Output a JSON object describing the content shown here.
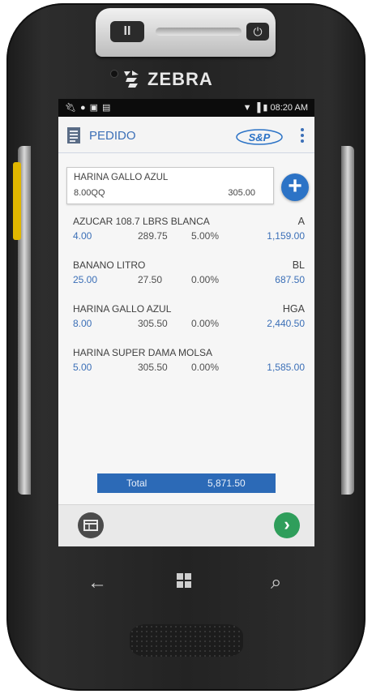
{
  "device": {
    "brand": "ZEBRA",
    "top_button_label": "II",
    "power_icon": "power-icon"
  },
  "statusbar": {
    "left_icons": [
      "usb-icon",
      "notification-icon",
      "clipboard-icon",
      "clipboard-icon"
    ],
    "time": "08:20 AM"
  },
  "appbar": {
    "title": "PEDIDO",
    "logo_text": "S&P",
    "menu_icon": "more-vert-icon"
  },
  "entry": {
    "product": "HARINA GALLO AZUL",
    "quantity": "8.00QQ",
    "price": "305.00"
  },
  "items": [
    {
      "name": "AZUCAR 108.7 LBRS BLANCA",
      "code": "A",
      "qty": "4.00",
      "price": "289.75",
      "discount": "5.00%",
      "total": "1,159.00"
    },
    {
      "name": "BANANO LITRO",
      "code": "BL",
      "qty": "25.00",
      "price": "27.50",
      "discount": "0.00%",
      "total": "687.50"
    },
    {
      "name": "HARINA GALLO AZUL",
      "code": "HGA",
      "qty": "8.00",
      "price": "305.50",
      "discount": "0.00%",
      "total": "2,440.50"
    },
    {
      "name": "HARINA SUPER DAMA MOLSA",
      "code": "",
      "qty": "5.00",
      "price": "305.50",
      "discount": "0.00%",
      "total": "1,585.00"
    }
  ],
  "total": {
    "label": "Total",
    "value": "5,871.50"
  },
  "colors": {
    "accent": "#2c73c6",
    "confirm": "#2f9e5b"
  }
}
